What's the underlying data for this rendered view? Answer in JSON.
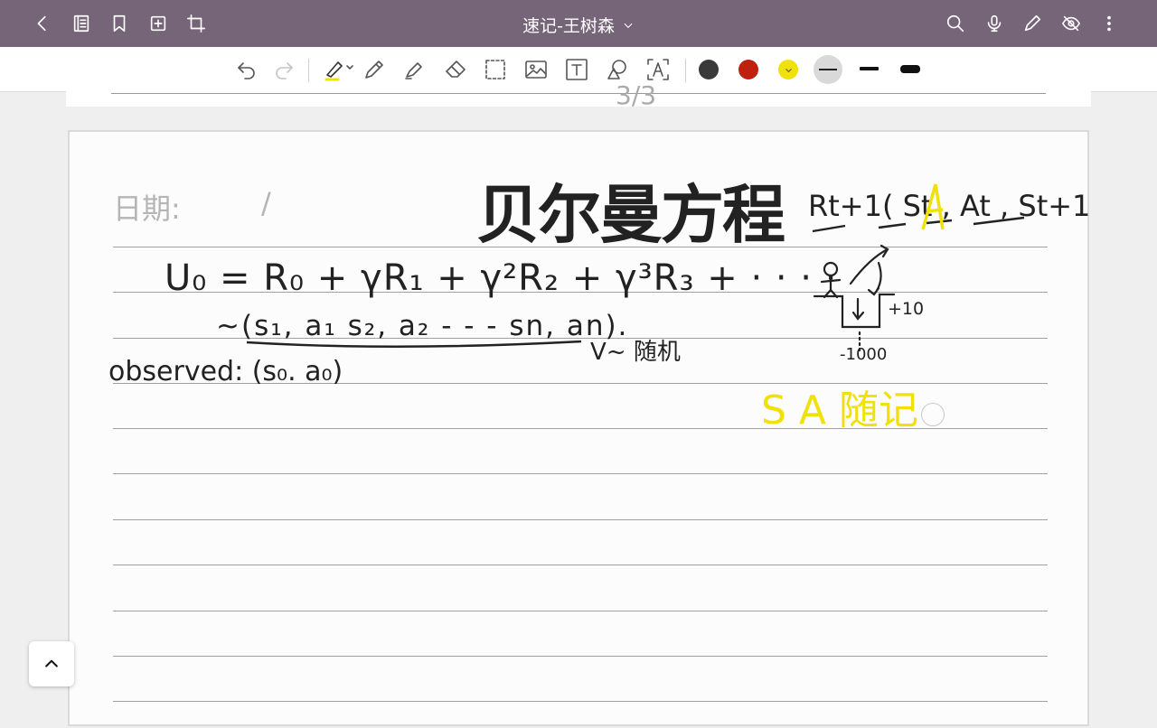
{
  "top_bar": {
    "title": "速记-王树森",
    "icons": [
      "back-icon",
      "notebook-icon",
      "bookmark-icon",
      "add-page-icon",
      "crop-icon",
      "search-icon",
      "microphone-icon",
      "pen-icon",
      "hide-icon",
      "more-icon"
    ]
  },
  "toolbar": {
    "tools": [
      "undo",
      "redo",
      "highlighter",
      "pen",
      "marker",
      "eraser",
      "lasso-select",
      "image",
      "text-box",
      "shapes",
      "text-recognition"
    ],
    "colors": [
      "#3a3a3a",
      "#c0200e",
      "#f1e10a"
    ],
    "selected_color": "#f1e10a",
    "stroke_widths": [
      "thin",
      "medium",
      "thick"
    ],
    "selected_stroke": "thin"
  },
  "previous_page": {
    "number": "3/3"
  },
  "note": {
    "date_label": "日期:",
    "date_slash": "/",
    "heading": "贝尔曼方程",
    "line1": "U₀ = R₀ + γR₁ + γ²R₂ + γ³R₃ + · · · ·",
    "line2": "~(s₁, a₁ s₂, a₂ - - - sn, an).",
    "line2_note": "V~ 随机",
    "line3": "observed: (s₀. a₀)",
    "reward_formula": "Rt+1( St , At , St+1)",
    "diagram_reward": "+10",
    "diagram_penalty": "-1000",
    "yellow_note": "S   A   随记"
  }
}
